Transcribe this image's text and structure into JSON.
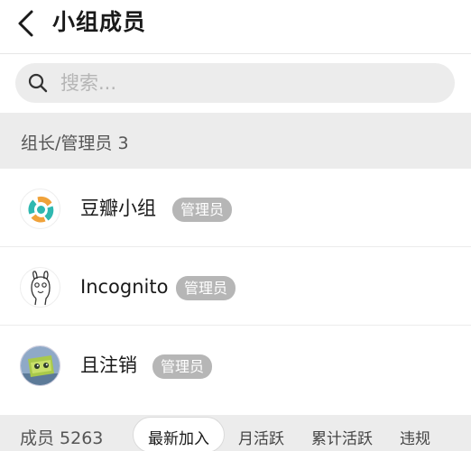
{
  "header": {
    "back_icon": "chevron-left-icon",
    "title": "小组成员"
  },
  "search": {
    "icon": "search-icon",
    "placeholder": "搜索...",
    "value": ""
  },
  "section": {
    "label": "组长/管理员 3"
  },
  "members": [
    {
      "name": "豆瓣小组",
      "role": "管理员",
      "avatar": "douban-group-logo"
    },
    {
      "name": "Incognito",
      "role": "管理员",
      "avatar": "ghost-doodle"
    },
    {
      "name": "且注销",
      "role": "管理员",
      "avatar": "green-character-photo"
    }
  ],
  "footer": {
    "count_label": "成员 5263",
    "tabs": [
      {
        "label": "最新加入",
        "active": true
      },
      {
        "label": "月活跃",
        "active": false
      },
      {
        "label": "累计活跃",
        "active": false
      },
      {
        "label": "违规",
        "active": false
      }
    ]
  }
}
